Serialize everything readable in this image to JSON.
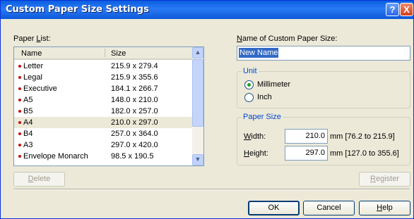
{
  "window": {
    "title": "Custom Paper Size Settings",
    "help_button": "?",
    "close_button": "X"
  },
  "paper_list": {
    "label_prefix": "Paper ",
    "label_accel": "L",
    "label_suffix": "ist:",
    "columns": [
      "Name",
      "Size"
    ],
    "rows": [
      {
        "name": "Letter",
        "size": "215.9 x 279.4"
      },
      {
        "name": "Legal",
        "size": "215.9 x 355.6"
      },
      {
        "name": "Executive",
        "size": "184.1 x 266.7"
      },
      {
        "name": "A5",
        "size": "148.0 x 210.0"
      },
      {
        "name": "B5",
        "size": "182.0 x 257.0"
      },
      {
        "name": "A4",
        "size": "210.0 x 297.0"
      },
      {
        "name": "B4",
        "size": "257.0 x 364.0"
      },
      {
        "name": "A3",
        "size": "297.0 x 420.0"
      },
      {
        "name": "Envelope Monarch",
        "size": "98.5 x 190.5"
      }
    ],
    "selected_index": 5,
    "scroll_up_icon": "▲",
    "scroll_down_icon": "▼"
  },
  "delete_button": {
    "accel": "D",
    "rest": "elete"
  },
  "custom_name": {
    "label_accel": "N",
    "label_rest": "ame of Custom Paper Size:",
    "value": "New Name"
  },
  "unit": {
    "group_label": "Unit",
    "millimeter_label": "Millimeter",
    "inch_label": "Inch",
    "selected": "Millimeter"
  },
  "paper_size": {
    "group_label": "Paper Size",
    "width_accel": "W",
    "width_rest": "idth:",
    "width_value": "210.0",
    "width_range": "mm [76.2 to 215.9]",
    "height_accel": "H",
    "height_rest": "eight:",
    "height_value": "297.0",
    "height_range": "mm [127.0 to 355.6]"
  },
  "register_button": {
    "accel": "R",
    "rest": "egister"
  },
  "footer": {
    "ok_label": "OK",
    "cancel_label": "Cancel",
    "help_accel": "H",
    "help_rest": "elp"
  },
  "colors": {
    "title_bar": "#0a5fe0",
    "selection": "#316ac5",
    "dialog_bg": "#ece9d8",
    "bullet": "#c8100b"
  }
}
